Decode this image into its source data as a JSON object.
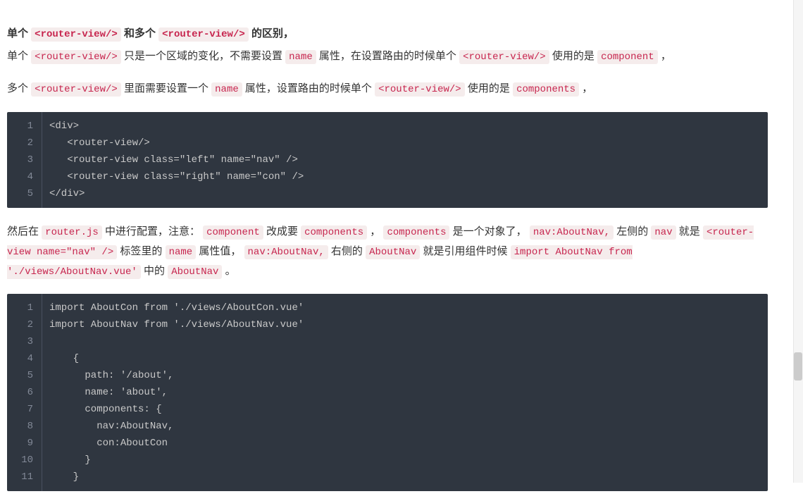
{
  "heading": {
    "t1": "单个 ",
    "c1": "<router-view/>",
    "t2": " 和多个 ",
    "c2": "<router-view/>",
    "t3": " 的区别，"
  },
  "p1": {
    "t1": "单个 ",
    "c1": "<router-view/>",
    "t2": " 只是一个区域的变化，不需要设置 ",
    "c2": "name",
    "t3": " 属性，在设置路由的时候单个 ",
    "c3": "<router-view/>",
    "t4": " 使用的是 ",
    "c4": "component",
    "t5": " ，"
  },
  "p2": {
    "t1": "多个 ",
    "c1": "<router-view/>",
    "t2": " 里面需要设置一个 ",
    "c2": "name",
    "t3": " 属性，设置路由的时候单个 ",
    "c3": "<router-view/>",
    "t4": " 使用的是 ",
    "c4": "components",
    "t5": " ，"
  },
  "codeblock1": [
    "<div>",
    "   <router-view/>",
    "   <router-view class=\"left\" name=\"nav\" />",
    "   <router-view class=\"right\" name=\"con\" />",
    "</div>"
  ],
  "p3": {
    "t1": "然后在 ",
    "c1": "router.js",
    "t2": " 中进行配置，注意： ",
    "c2": "component",
    "t3": " 改成要 ",
    "c3": "components",
    "t4": " ， ",
    "c4": "components",
    "t5": " 是一个对象了， ",
    "c5": "nav:AboutNav,",
    "t6": " 左侧的 ",
    "c6": "nav",
    "t7": " 就是 ",
    "c7": "<router-view name=\"nav\" />",
    "t8": " 标签里的 ",
    "c8": "name",
    "t9": " 属性值， ",
    "c9": "nav:AboutNav,",
    "t10": " 右侧的 ",
    "c10": "AboutNav",
    "t11": " 就是引用组件时候 ",
    "c11": "import AboutNav from './views/AboutNav.vue'",
    "t12": " 中的 ",
    "c12": "AboutNav",
    "t13": " 。"
  },
  "codeblock2": [
    "import AboutCon from './views/AboutCon.vue'",
    "import AboutNav from './views/AboutNav.vue'",
    "",
    "    {",
    "      path: '/about',",
    "      name: 'about',",
    "      components: {",
    "        nav:AboutNav,",
    "        con:AboutCon",
    "      }",
    "    }"
  ]
}
